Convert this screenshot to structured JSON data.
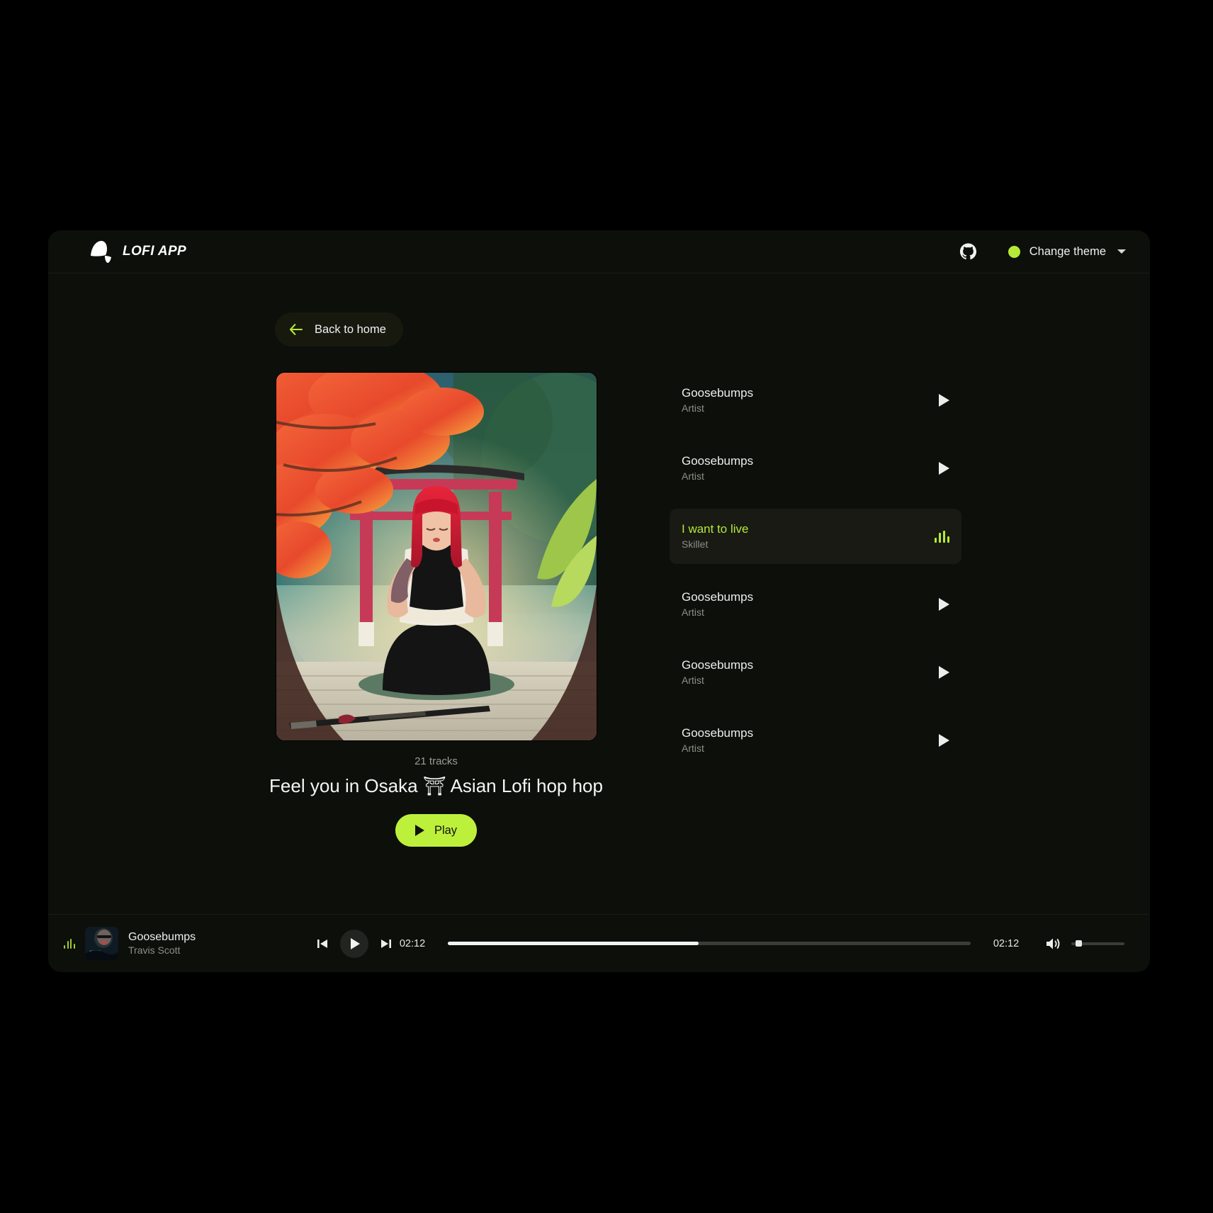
{
  "header": {
    "brand_name": "LOFI APP",
    "github_icon": "github-icon",
    "theme_label": "Change theme",
    "theme_dot_color": "#b5e938"
  },
  "nav": {
    "back_label": "Back to home"
  },
  "album": {
    "tracks_count": "21 tracks",
    "title": "Feel you in Osaka ⛩ Asian Lofi hop hop",
    "play_label": "Play",
    "cover_alt": "anime-woman-kneeling-before-torii-gate"
  },
  "tracks": [
    {
      "title": "Goosebumps",
      "artist": "Artist",
      "active": false
    },
    {
      "title": "Goosebumps",
      "artist": "Artist",
      "active": false
    },
    {
      "title": "I want to live",
      "artist": "Skillet",
      "active": true
    },
    {
      "title": "Goosebumps",
      "artist": "Artist",
      "active": false
    },
    {
      "title": "Goosebumps",
      "artist": "Artist",
      "active": false
    },
    {
      "title": "Goosebumps",
      "artist": "Artist",
      "active": false
    }
  ],
  "player": {
    "now_playing_title": "Goosebumps",
    "now_playing_artist": "Travis Scott",
    "current_time": "02:12",
    "total_time": "02:12",
    "progress_percent": 48,
    "volume_percent": 10,
    "accent_color": "#b5e938"
  }
}
